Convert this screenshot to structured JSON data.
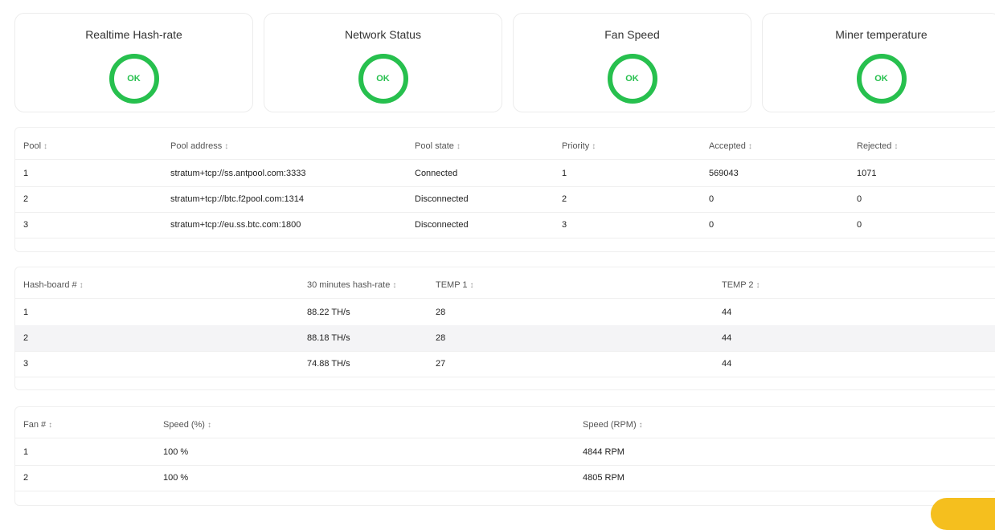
{
  "status_cards": [
    {
      "title": "Realtime Hash-rate",
      "status": "OK"
    },
    {
      "title": "Network Status",
      "status": "OK"
    },
    {
      "title": "Fan Speed",
      "status": "OK"
    },
    {
      "title": "Miner temperature",
      "status": "OK"
    }
  ],
  "pools": {
    "headers": [
      "Pool",
      "Pool address",
      "Pool state",
      "Priority",
      "Accepted",
      "Rejected"
    ],
    "rows": [
      [
        "1",
        "stratum+tcp://ss.antpool.com:3333",
        "Connected",
        "1",
        "569043",
        "1071"
      ],
      [
        "2",
        "stratum+tcp://btc.f2pool.com:1314",
        "Disconnected",
        "2",
        "0",
        "0"
      ],
      [
        "3",
        "stratum+tcp://eu.ss.btc.com:1800",
        "Disconnected",
        "3",
        "0",
        "0"
      ]
    ]
  },
  "hashboards": {
    "headers": [
      "Hash-board #",
      "30 minutes hash-rate",
      "TEMP 1",
      "TEMP 2"
    ],
    "rows": [
      [
        "1",
        "88.22 TH/s",
        "28",
        "44"
      ],
      [
        "2",
        "88.18 TH/s",
        "28",
        "44"
      ],
      [
        "3",
        "74.88 TH/s",
        "27",
        "44"
      ]
    ]
  },
  "fans": {
    "headers": [
      "Fan #",
      "Speed (%)",
      "Speed (RPM)"
    ],
    "rows": [
      [
        "1",
        "100 %",
        "4844 RPM"
      ],
      [
        "2",
        "100 %",
        "4805 RPM"
      ]
    ]
  },
  "colors": {
    "ok": "#27c04e",
    "help_button": "#f5bf1e"
  },
  "icons": {
    "sort": "sort-arrows-icon"
  },
  "sort_glyph": "↕"
}
